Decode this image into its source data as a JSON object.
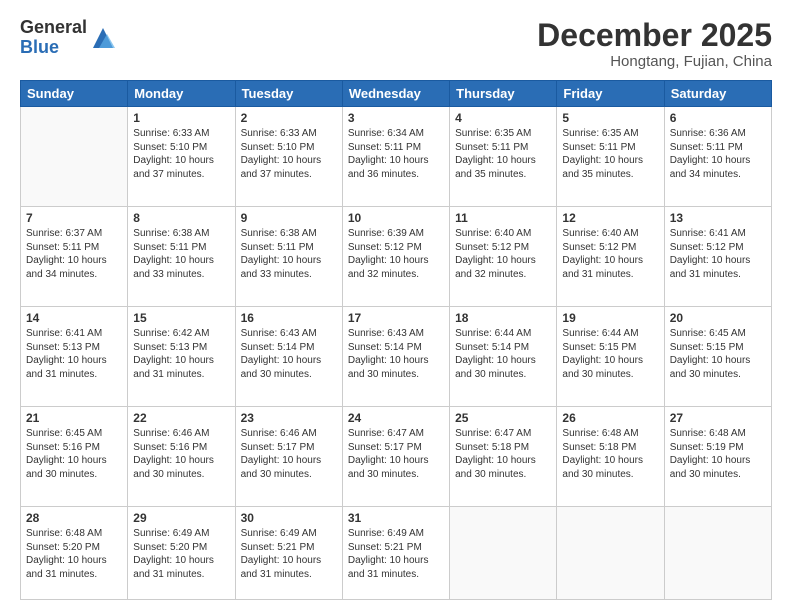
{
  "logo": {
    "general": "General",
    "blue": "Blue"
  },
  "title": "December 2025",
  "subtitle": "Hongtang, Fujian, China",
  "days_of_week": [
    "Sunday",
    "Monday",
    "Tuesday",
    "Wednesday",
    "Thursday",
    "Friday",
    "Saturday"
  ],
  "weeks": [
    [
      {
        "day": "",
        "info": ""
      },
      {
        "day": "1",
        "info": "Sunrise: 6:33 AM\nSunset: 5:10 PM\nDaylight: 10 hours and 37 minutes."
      },
      {
        "day": "2",
        "info": "Sunrise: 6:33 AM\nSunset: 5:10 PM\nDaylight: 10 hours and 37 minutes."
      },
      {
        "day": "3",
        "info": "Sunrise: 6:34 AM\nSunset: 5:11 PM\nDaylight: 10 hours and 36 minutes."
      },
      {
        "day": "4",
        "info": "Sunrise: 6:35 AM\nSunset: 5:11 PM\nDaylight: 10 hours and 35 minutes."
      },
      {
        "day": "5",
        "info": "Sunrise: 6:35 AM\nSunset: 5:11 PM\nDaylight: 10 hours and 35 minutes."
      },
      {
        "day": "6",
        "info": "Sunrise: 6:36 AM\nSunset: 5:11 PM\nDaylight: 10 hours and 34 minutes."
      }
    ],
    [
      {
        "day": "7",
        "info": "Sunrise: 6:37 AM\nSunset: 5:11 PM\nDaylight: 10 hours and 34 minutes."
      },
      {
        "day": "8",
        "info": "Sunrise: 6:38 AM\nSunset: 5:11 PM\nDaylight: 10 hours and 33 minutes."
      },
      {
        "day": "9",
        "info": "Sunrise: 6:38 AM\nSunset: 5:11 PM\nDaylight: 10 hours and 33 minutes."
      },
      {
        "day": "10",
        "info": "Sunrise: 6:39 AM\nSunset: 5:12 PM\nDaylight: 10 hours and 32 minutes."
      },
      {
        "day": "11",
        "info": "Sunrise: 6:40 AM\nSunset: 5:12 PM\nDaylight: 10 hours and 32 minutes."
      },
      {
        "day": "12",
        "info": "Sunrise: 6:40 AM\nSunset: 5:12 PM\nDaylight: 10 hours and 31 minutes."
      },
      {
        "day": "13",
        "info": "Sunrise: 6:41 AM\nSunset: 5:12 PM\nDaylight: 10 hours and 31 minutes."
      }
    ],
    [
      {
        "day": "14",
        "info": "Sunrise: 6:41 AM\nSunset: 5:13 PM\nDaylight: 10 hours and 31 minutes."
      },
      {
        "day": "15",
        "info": "Sunrise: 6:42 AM\nSunset: 5:13 PM\nDaylight: 10 hours and 31 minutes."
      },
      {
        "day": "16",
        "info": "Sunrise: 6:43 AM\nSunset: 5:14 PM\nDaylight: 10 hours and 30 minutes."
      },
      {
        "day": "17",
        "info": "Sunrise: 6:43 AM\nSunset: 5:14 PM\nDaylight: 10 hours and 30 minutes."
      },
      {
        "day": "18",
        "info": "Sunrise: 6:44 AM\nSunset: 5:14 PM\nDaylight: 10 hours and 30 minutes."
      },
      {
        "day": "19",
        "info": "Sunrise: 6:44 AM\nSunset: 5:15 PM\nDaylight: 10 hours and 30 minutes."
      },
      {
        "day": "20",
        "info": "Sunrise: 6:45 AM\nSunset: 5:15 PM\nDaylight: 10 hours and 30 minutes."
      }
    ],
    [
      {
        "day": "21",
        "info": "Sunrise: 6:45 AM\nSunset: 5:16 PM\nDaylight: 10 hours and 30 minutes."
      },
      {
        "day": "22",
        "info": "Sunrise: 6:46 AM\nSunset: 5:16 PM\nDaylight: 10 hours and 30 minutes."
      },
      {
        "day": "23",
        "info": "Sunrise: 6:46 AM\nSunset: 5:17 PM\nDaylight: 10 hours and 30 minutes."
      },
      {
        "day": "24",
        "info": "Sunrise: 6:47 AM\nSunset: 5:17 PM\nDaylight: 10 hours and 30 minutes."
      },
      {
        "day": "25",
        "info": "Sunrise: 6:47 AM\nSunset: 5:18 PM\nDaylight: 10 hours and 30 minutes."
      },
      {
        "day": "26",
        "info": "Sunrise: 6:48 AM\nSunset: 5:18 PM\nDaylight: 10 hours and 30 minutes."
      },
      {
        "day": "27",
        "info": "Sunrise: 6:48 AM\nSunset: 5:19 PM\nDaylight: 10 hours and 30 minutes."
      }
    ],
    [
      {
        "day": "28",
        "info": "Sunrise: 6:48 AM\nSunset: 5:20 PM\nDaylight: 10 hours and 31 minutes."
      },
      {
        "day": "29",
        "info": "Sunrise: 6:49 AM\nSunset: 5:20 PM\nDaylight: 10 hours and 31 minutes."
      },
      {
        "day": "30",
        "info": "Sunrise: 6:49 AM\nSunset: 5:21 PM\nDaylight: 10 hours and 31 minutes."
      },
      {
        "day": "31",
        "info": "Sunrise: 6:49 AM\nSunset: 5:21 PM\nDaylight: 10 hours and 31 minutes."
      },
      {
        "day": "",
        "info": ""
      },
      {
        "day": "",
        "info": ""
      },
      {
        "day": "",
        "info": ""
      }
    ]
  ]
}
